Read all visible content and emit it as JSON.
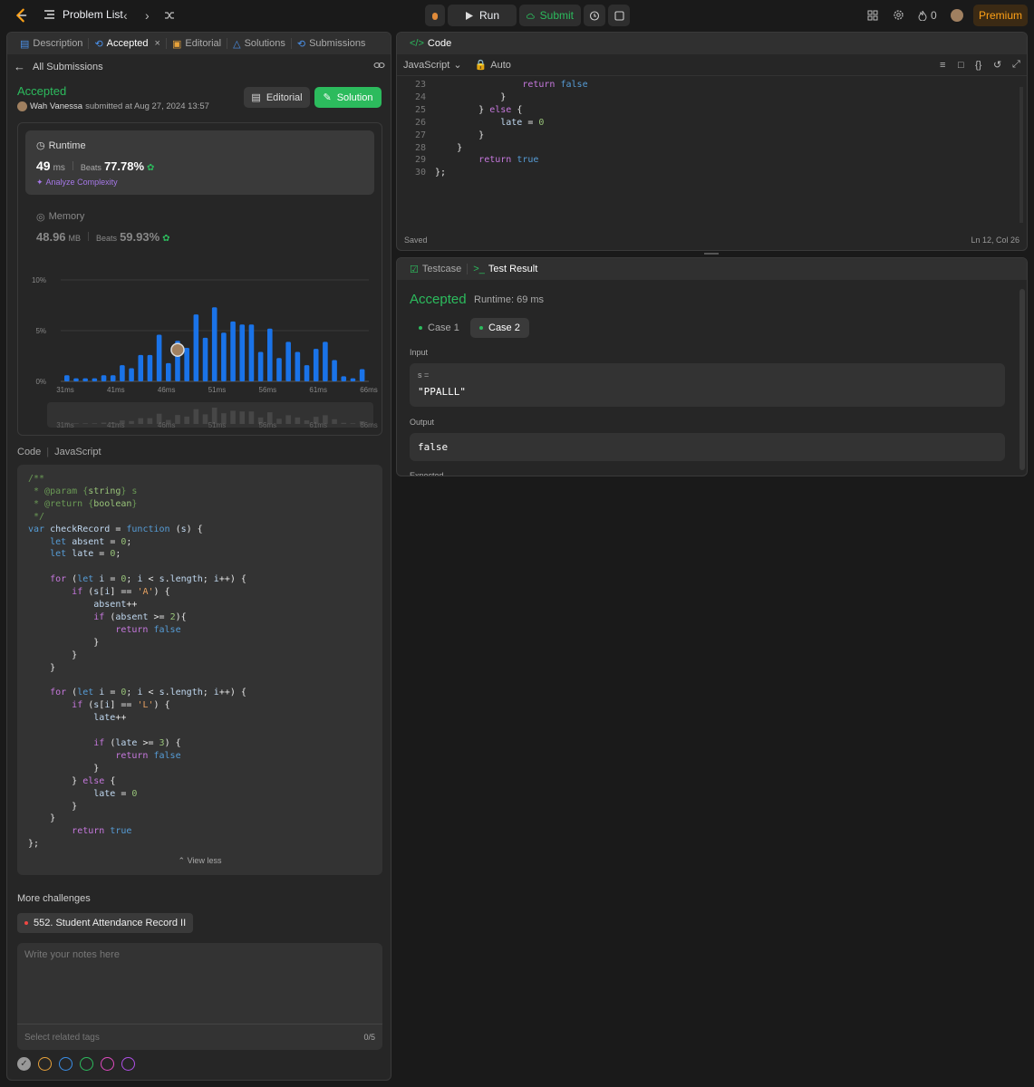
{
  "topbar": {
    "problem_list": "Problem List",
    "run": "Run",
    "submit": "Submit",
    "streak": "0",
    "premium": "Premium"
  },
  "left_tabs": [
    {
      "label": "Description"
    },
    {
      "label": "Accepted"
    },
    {
      "label": "Editorial"
    },
    {
      "label": "Solutions"
    },
    {
      "label": "Submissions"
    }
  ],
  "submission": {
    "back": "All Submissions",
    "status": "Accepted",
    "user": "Wah Vanessa",
    "submitted": "submitted at Aug 27, 2024 13:57",
    "editorial_btn": "Editorial",
    "solution_btn": "Solution"
  },
  "runtime": {
    "title": "Runtime",
    "value": "49",
    "unit": "ms",
    "beats_label": "Beats",
    "beats": "77.78%",
    "analyze": "Analyze Complexity"
  },
  "memory": {
    "title": "Memory",
    "value": "48.96",
    "unit": "MB",
    "beats_label": "Beats",
    "beats": "59.93%"
  },
  "chart_data": {
    "type": "bar",
    "y_ticks": [
      "10%",
      "5%",
      "0%"
    ],
    "x_ticks": [
      "31ms",
      "41ms",
      "46ms",
      "51ms",
      "56ms",
      "61ms",
      "66ms"
    ],
    "ylim": [
      0,
      10
    ],
    "values": [
      0.6,
      0.3,
      0.3,
      0.3,
      0.6,
      0.6,
      1.6,
      1.3,
      2.6,
      2.6,
      4.6,
      1.8,
      4.0,
      3.3,
      6.6,
      4.3,
      7.3,
      4.8,
      5.9,
      5.6,
      5.6,
      2.9,
      5.2,
      2.3,
      3.9,
      2.9,
      1.6,
      3.2,
      3.9,
      2.1,
      0.5,
      0.3,
      1.2
    ],
    "highlight_index": 12
  },
  "code_section": {
    "label": "Code",
    "lang": "JavaScript",
    "view_less": "View less"
  },
  "more": {
    "title": "More challenges",
    "item": "552. Student Attendance Record II"
  },
  "notes": {
    "placeholder": "Write your notes here",
    "tags": "Select related tags",
    "count": "0/5"
  },
  "editor": {
    "title": "Code",
    "lang": "JavaScript",
    "mode": "Auto",
    "saved": "Saved",
    "position": "Ln 12, Col 26",
    "line_numbers": [
      "23",
      "24",
      "25",
      "26",
      "27",
      "28",
      "29",
      "30"
    ]
  },
  "result": {
    "tab_testcase": "Testcase",
    "tab_result": "Test Result",
    "status": "Accepted",
    "runtime": "Runtime: 69 ms",
    "case1": "Case 1",
    "case2": "Case 2",
    "input_label": "Input",
    "input_var": "s =",
    "input_value": "\"PPALLL\"",
    "output_label": "Output",
    "output_value": "false",
    "expected_label": "Expected"
  },
  "colors": {
    "green": "#2cbb5d",
    "bar": "#1a73e8",
    "accent": "#ffa116"
  }
}
